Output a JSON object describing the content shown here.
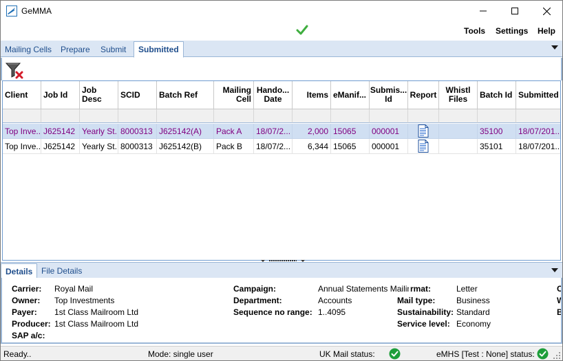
{
  "window": {
    "title": "GeMMA",
    "icon": "gemma-logo-icon"
  },
  "menu": {
    "status_icon": "green-check-icon",
    "items": [
      "Tools",
      "Settings",
      "Help"
    ]
  },
  "tabs": [
    "Mailing Cells",
    "Prepare",
    "Submit",
    "Submitted"
  ],
  "active_tab": "Submitted",
  "toolbar": {
    "clear_filter_icon": "clear-filter-icon"
  },
  "grid": {
    "columns": [
      "Client",
      "Job Id",
      "Job Desc",
      "SCID",
      "Batch Ref",
      "Mailing Cell",
      "Handover Date",
      "Items",
      "eManifest",
      "Submission Id",
      "Report",
      "Whistl Files",
      "Batch Id",
      "Submitted"
    ],
    "column_display": [
      "Client",
      "Job Id",
      "Job\nDesc",
      "SCID",
      "Batch Ref",
      "Mailing\nCell",
      "Hando...\nDate",
      "Items",
      "eManif...",
      "Submis...\nId",
      "Report",
      "Whistl\nFiles",
      "Batch Id",
      "Submitted"
    ],
    "rows": [
      {
        "client": "Top Inve...",
        "job_id": "J625142",
        "job_desc": "Yearly St...",
        "scid": "8000313",
        "batch_ref": "J625142(A)",
        "mailing_cell": "Pack A",
        "handover_date": "18/07/2...",
        "items": "2,000",
        "emanifest": "15065",
        "submission_id": "000001",
        "report_icon": "document-icon",
        "whistl_files": "",
        "batch_id": "35100",
        "submitted": "18/07/201...",
        "selected": true
      },
      {
        "client": "Top Inve...",
        "job_id": "J625142",
        "job_desc": "Yearly St...",
        "scid": "8000313",
        "batch_ref": "J625142(B)",
        "mailing_cell": "Pack B",
        "handover_date": "18/07/2...",
        "items": "6,344",
        "emanifest": "15065",
        "submission_id": "000001",
        "report_icon": "document-icon",
        "whistl_files": "",
        "batch_id": "35101",
        "submitted": "18/07/201...",
        "selected": false
      }
    ]
  },
  "details_tabs": [
    "Details",
    "File Details"
  ],
  "active_details_tab": "Details",
  "details": {
    "col1": [
      {
        "label": "Carrier:",
        "value": "Royal Mail"
      },
      {
        "label": "Owner:",
        "value": "Top Investments"
      },
      {
        "label": "Payer:",
        "value": "1st Class Mailroom Ltd"
      },
      {
        "label": "Producer:",
        "value": "1st Class Mailroom Ltd"
      },
      {
        "label": "SAP a/c:",
        "value": ""
      }
    ],
    "col2": [
      {
        "label": "Campaign:",
        "value": "Annual Statements Mailing"
      },
      {
        "label": "Department:",
        "value": "Accounts"
      },
      {
        "label": "Sequence no range:",
        "value": "1..4095"
      }
    ],
    "col3": [
      {
        "label": "rmat:",
        "value": "Letter"
      },
      {
        "label": "Mail type:",
        "value": "Business"
      },
      {
        "label": "Sustainability:",
        "value": "Standard"
      },
      {
        "label": "Service level:",
        "value": "Economy"
      }
    ],
    "col4_clipped": [
      "C",
      "W",
      "B"
    ]
  },
  "status": {
    "ready": "Ready..",
    "mode": "Mode: single user",
    "uk_mail": "UK Mail status:",
    "emhs": "eMHS [Test : None] status:",
    "ok_icon": "green-check-circle-icon"
  },
  "colors": {
    "selected_row_bg": "#d0dff2",
    "selected_row_text": "#800080",
    "tab_strip_bg": "#dbe6f4",
    "accent": "#1f4e8c",
    "status_ok": "#1e9e3a"
  }
}
